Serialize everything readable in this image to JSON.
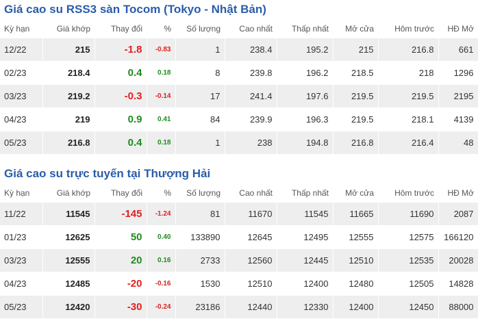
{
  "colors": {
    "title": "#2a5caa",
    "positive": "#1e8c1e",
    "negative": "#e02020",
    "row_alt": "#eeeeee"
  },
  "headers": [
    "Kỳ hạn",
    "Giá khớp",
    "Thay đổi",
    "%",
    "Số lượng",
    "Cao nhất",
    "Thấp nhất",
    "Mở cửa",
    "Hôm trước",
    "HĐ Mở"
  ],
  "tables": [
    {
      "title": "Giá cao su RSS3 sàn Tocom (Tokyo - Nhật Bản)",
      "rows": [
        {
          "term": "12/22",
          "price": "215",
          "change": "-1.8",
          "pct": "-0.83",
          "direction": "down",
          "volume": "1",
          "high": "238.4",
          "low": "195.2",
          "open": "215",
          "prev": "216.8",
          "oi": "661"
        },
        {
          "term": "02/23",
          "price": "218.4",
          "change": "0.4",
          "pct": "0.18",
          "direction": "up",
          "volume": "8",
          "high": "239.8",
          "low": "196.2",
          "open": "218.5",
          "prev": "218",
          "oi": "1296"
        },
        {
          "term": "03/23",
          "price": "219.2",
          "change": "-0.3",
          "pct": "-0.14",
          "direction": "down",
          "volume": "17",
          "high": "241.4",
          "low": "197.6",
          "open": "219.5",
          "prev": "219.5",
          "oi": "2195"
        },
        {
          "term": "04/23",
          "price": "219",
          "change": "0.9",
          "pct": "0.41",
          "direction": "up",
          "volume": "84",
          "high": "239.9",
          "low": "196.3",
          "open": "219.5",
          "prev": "218.1",
          "oi": "4139"
        },
        {
          "term": "05/23",
          "price": "216.8",
          "change": "0.4",
          "pct": "0.18",
          "direction": "up",
          "volume": "1",
          "high": "238",
          "low": "194.8",
          "open": "216.8",
          "prev": "216.4",
          "oi": "48"
        }
      ]
    },
    {
      "title": "Giá cao su trực tuyến tại Thượng Hải",
      "rows": [
        {
          "term": "11/22",
          "price": "11545",
          "change": "-145",
          "pct": "-1.24",
          "direction": "down",
          "volume": "81",
          "high": "11670",
          "low": "11545",
          "open": "11665",
          "prev": "11690",
          "oi": "2087"
        },
        {
          "term": "01/23",
          "price": "12625",
          "change": "50",
          "pct": "0.40",
          "direction": "up",
          "volume": "133890",
          "high": "12645",
          "low": "12495",
          "open": "12555",
          "prev": "12575",
          "oi": "166120"
        },
        {
          "term": "03/23",
          "price": "12555",
          "change": "20",
          "pct": "0.16",
          "direction": "up",
          "volume": "2733",
          "high": "12560",
          "low": "12445",
          "open": "12510",
          "prev": "12535",
          "oi": "20028"
        },
        {
          "term": "04/23",
          "price": "12485",
          "change": "-20",
          "pct": "-0.16",
          "direction": "down",
          "volume": "1530",
          "high": "12510",
          "low": "12400",
          "open": "12480",
          "prev": "12505",
          "oi": "14828"
        },
        {
          "term": "05/23",
          "price": "12420",
          "change": "-30",
          "pct": "-0.24",
          "direction": "down",
          "volume": "23186",
          "high": "12440",
          "low": "12330",
          "open": "12400",
          "prev": "12450",
          "oi": "88000"
        }
      ]
    }
  ]
}
